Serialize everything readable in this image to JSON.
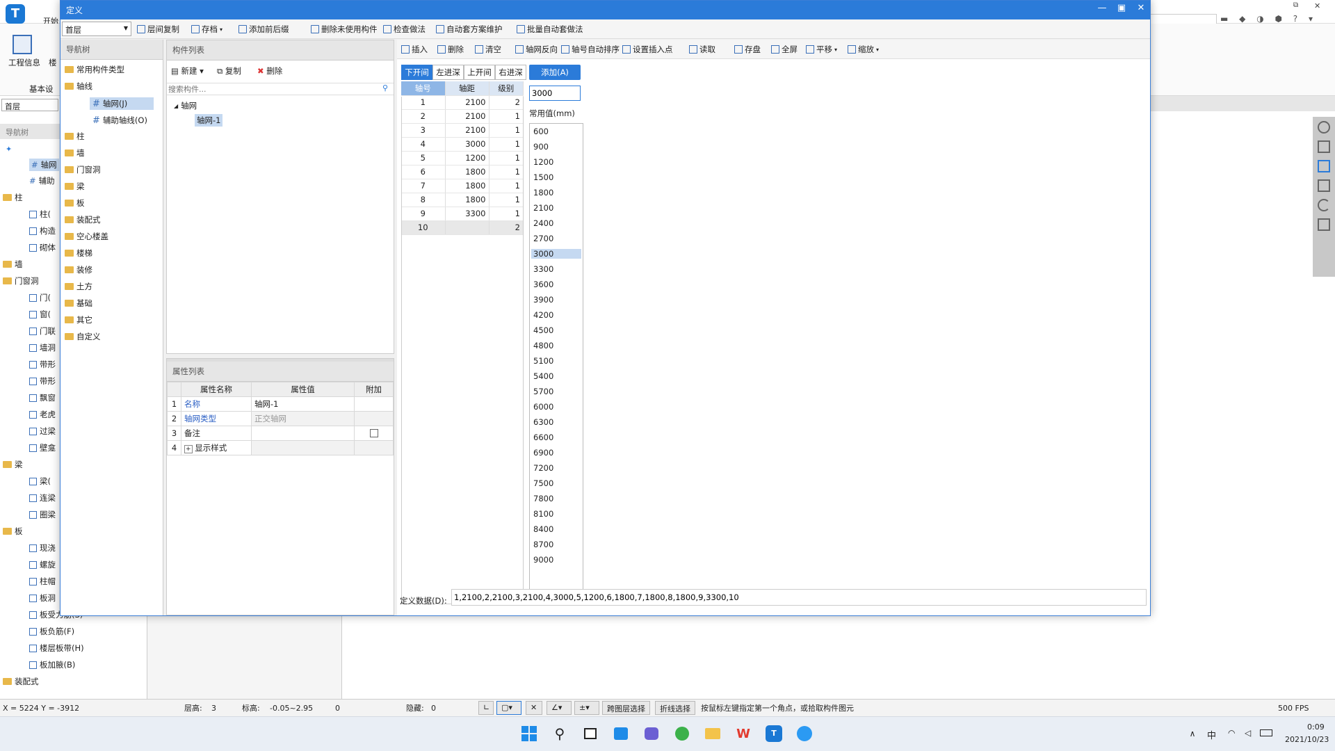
{
  "app": {
    "title_tab": "开始",
    "ribbon_left": [
      "工程信息",
      "楼"
    ],
    "basic_settings": "基本设",
    "floor_select": "首层",
    "nav_tree_label": "导航树"
  },
  "bg_nav": {
    "groups": [
      {
        "label": "柱",
        "items": [
          "柱(",
          "构造",
          "砌体"
        ]
      },
      {
        "label": "墙",
        "items": []
      },
      {
        "label": "门窗洞",
        "items": [
          "门(",
          "窗(",
          "门联",
          "墙洞",
          "带形",
          "带形",
          "飘窗",
          "老虎",
          "过梁",
          "壁龛"
        ]
      },
      {
        "label": "梁",
        "items": [
          "梁(",
          "连梁",
          "圈梁"
        ]
      },
      {
        "label": "板",
        "items": [
          "现浇",
          "螺旋",
          "柱帽",
          "板洞",
          "板受力筋(S)",
          "板负筋(F)",
          "楼层板带(H)",
          "板加腋(B)"
        ]
      },
      {
        "label": "装配式",
        "items": []
      }
    ],
    "top_items": [
      "轴网",
      "辅助"
    ]
  },
  "status": {
    "coords": "X = 5224 Y = -3912",
    "floor_height_label": "层高:",
    "floor_height": "3",
    "elevation_label": "标高:",
    "elevation": "-0.05~2.95",
    "zero": "0",
    "hidden_label": "隐藏:",
    "hidden": "0",
    "cross_floor": "跨图层选择",
    "polyline": "折线选择",
    "hint": "按鼠标左键指定第一个角点，或拾取构件图元",
    "fps": "500 FPS"
  },
  "taskbar": {
    "ime": "中",
    "time": "0:09",
    "date": "2021/10/23"
  },
  "dialog": {
    "title": "定义",
    "floor": "首层",
    "toolbar": [
      "层间复制",
      "存档",
      "添加前后缀",
      "删除未使用构件",
      "检查做法",
      "自动套方案维护",
      "批量自动套做法"
    ],
    "nav_title": "导航树",
    "nav_items": [
      "常用构件类型",
      "轴线",
      "柱",
      "墙",
      "门窗洞",
      "梁",
      "板",
      "装配式",
      "空心楼盖",
      "楼梯",
      "装修",
      "土方",
      "基础",
      "其它",
      "自定义"
    ],
    "nav_sub": [
      "轴网(J)",
      "辅助轴线(O)"
    ],
    "comp_list_title": "构件列表",
    "comp_toolbar": [
      "新建",
      "复制",
      "删除"
    ],
    "search_placeholder": "搜索构件...",
    "comp_root": "轴网",
    "comp_child": "轴网-1",
    "prop_title": "属性列表",
    "prop_headers": [
      "属性名称",
      "属性值",
      "附加"
    ],
    "props": [
      {
        "no": "1",
        "name": "名称",
        "value": "轴网-1"
      },
      {
        "no": "2",
        "name": "轴网类型",
        "value": "正交轴网"
      },
      {
        "no": "3",
        "name": "备注",
        "value": ""
      },
      {
        "no": "4",
        "name": "显示样式",
        "value": ""
      }
    ],
    "grid_toolbar": [
      "插入",
      "删除",
      "清空",
      "轴网反向",
      "轴号自动排序",
      "设置插入点",
      "读取",
      "存盘",
      "全屏",
      "平移",
      "缩放"
    ],
    "tabs": [
      "下开间",
      "左进深",
      "上开间",
      "右进深"
    ],
    "grid_headers": [
      "轴号",
      "轴距",
      "级别"
    ],
    "grid_rows": [
      [
        "1",
        "2100",
        "2"
      ],
      [
        "2",
        "2100",
        "1"
      ],
      [
        "3",
        "2100",
        "1"
      ],
      [
        "4",
        "3000",
        "1"
      ],
      [
        "5",
        "1200",
        "1"
      ],
      [
        "6",
        "1800",
        "1"
      ],
      [
        "7",
        "1800",
        "1"
      ],
      [
        "8",
        "1800",
        "1"
      ],
      [
        "9",
        "3300",
        "1"
      ],
      [
        "10",
        "",
        "2"
      ]
    ],
    "add_button": "添加(A)",
    "input_value": "3000",
    "common_label": "常用值(mm)",
    "common_values": [
      "600",
      "900",
      "1200",
      "1500",
      "1800",
      "2100",
      "2400",
      "2700",
      "3000",
      "3300",
      "3600",
      "3900",
      "4200",
      "4500",
      "4800",
      "5100",
      "5400",
      "5700",
      "6000",
      "6300",
      "6600",
      "6900",
      "7200",
      "7500",
      "7800",
      "8100",
      "8400",
      "8700",
      "9000"
    ],
    "selected_common": "3000",
    "def_label": "定义数据(D):",
    "def_value": "1,2100,2,2100,3,2100,4,3000,5,1200,6,1800,7,1800,8,1800,9,3300,10"
  },
  "colors": {
    "accent": "#2b7bd9",
    "selected": "#c5d9f1",
    "folder": "#e8b84a"
  }
}
